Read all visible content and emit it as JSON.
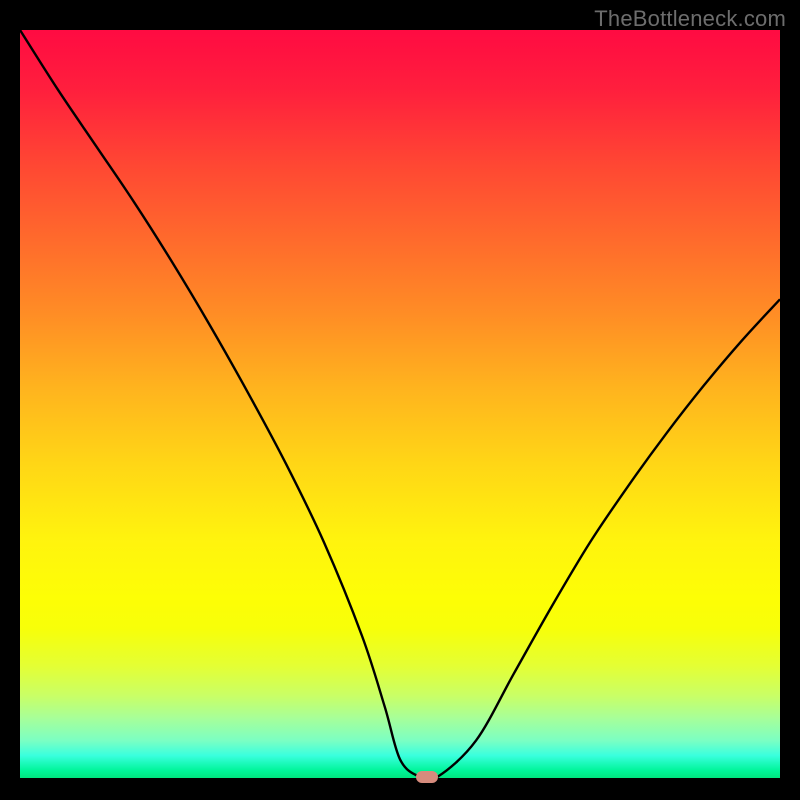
{
  "watermark": "TheBottleneck.com",
  "colors": {
    "curve_stroke": "#000000",
    "marker_fill": "#d68b7d",
    "frame_bg": "#000000"
  },
  "chart_data": {
    "type": "line",
    "title": "",
    "xlabel": "",
    "ylabel": "",
    "xlim": [
      0,
      100
    ],
    "ylim": [
      0,
      100
    ],
    "grid": false,
    "series": [
      {
        "name": "bottleneck-curve",
        "x": [
          0,
          5,
          10,
          15,
          20,
          25,
          30,
          35,
          40,
          45,
          48,
          50,
          52.5,
          55,
          60,
          65,
          70,
          75,
          80,
          85,
          90,
          95,
          100
        ],
        "y": [
          100,
          92,
          84.5,
          77,
          69,
          60.5,
          51.5,
          42,
          31.5,
          19,
          9.5,
          2.5,
          0.2,
          0.2,
          5,
          14,
          23,
          31.5,
          39,
          46,
          52.5,
          58.5,
          64
        ]
      }
    ],
    "annotations": [
      {
        "name": "optimal-point",
        "x": 53.5,
        "y": 0.2
      }
    ]
  }
}
